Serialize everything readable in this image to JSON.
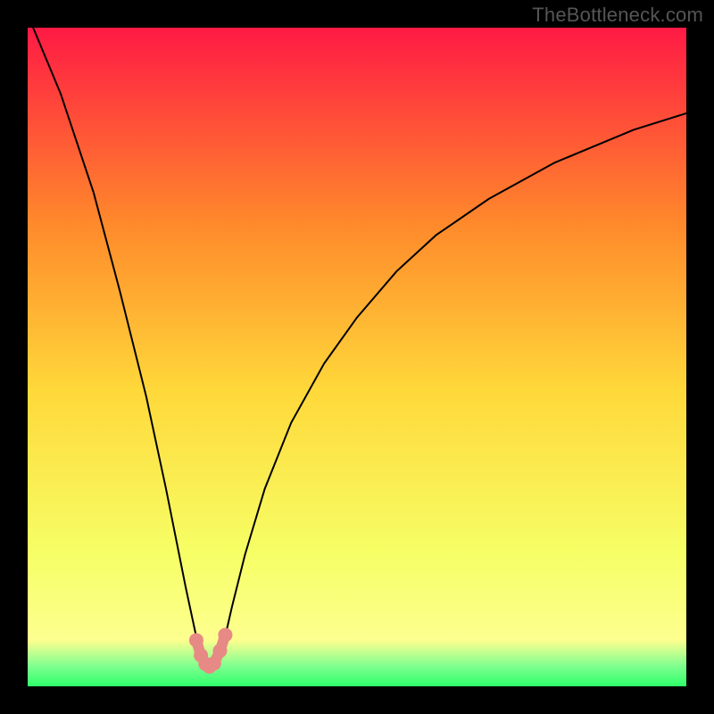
{
  "watermark": "TheBottleneck.com",
  "colors": {
    "frame": "#000000",
    "gradient_top": "#ff1a44",
    "gradient_upper_mid": "#ff8a2b",
    "gradient_mid": "#ffd83a",
    "gradient_lower_mid": "#f6ff66",
    "gradient_base_yellow": "#fdff8f",
    "gradient_green_band": "#2eff6a",
    "curve_stroke": "#000000",
    "marker_fill": "#e78a85",
    "marker_stroke": "#cf6b64"
  },
  "chart_data": {
    "type": "line",
    "title": "",
    "xlabel": "",
    "ylabel": "",
    "xlim": [
      0,
      100
    ],
    "ylim": [
      0,
      100
    ],
    "series": [
      {
        "name": "bottleneck-curve",
        "x": [
          0,
          5,
          10,
          14,
          18,
          21,
          24,
          25.5,
          26.5,
          27,
          27.3,
          27.6,
          28,
          28.5,
          29,
          29.5,
          30.2,
          31,
          33,
          36,
          40,
          45,
          50,
          56,
          62,
          70,
          80,
          92,
          100
        ],
        "y": [
          102,
          90,
          75,
          60,
          44,
          30,
          15,
          8,
          4.5,
          3.3,
          3,
          3,
          3.2,
          3.4,
          4.2,
          6,
          8.5,
          12,
          20,
          30,
          40,
          49,
          56,
          63,
          68.5,
          74,
          79.5,
          84.5,
          87
        ]
      }
    ],
    "markers": {
      "name": "highlighted-minimum",
      "x": [
        25.6,
        26.3,
        27.0,
        27.6,
        28.3,
        29.2,
        30.0
      ],
      "y": [
        7.0,
        4.7,
        3.4,
        3.0,
        3.5,
        5.4,
        7.8
      ]
    }
  }
}
